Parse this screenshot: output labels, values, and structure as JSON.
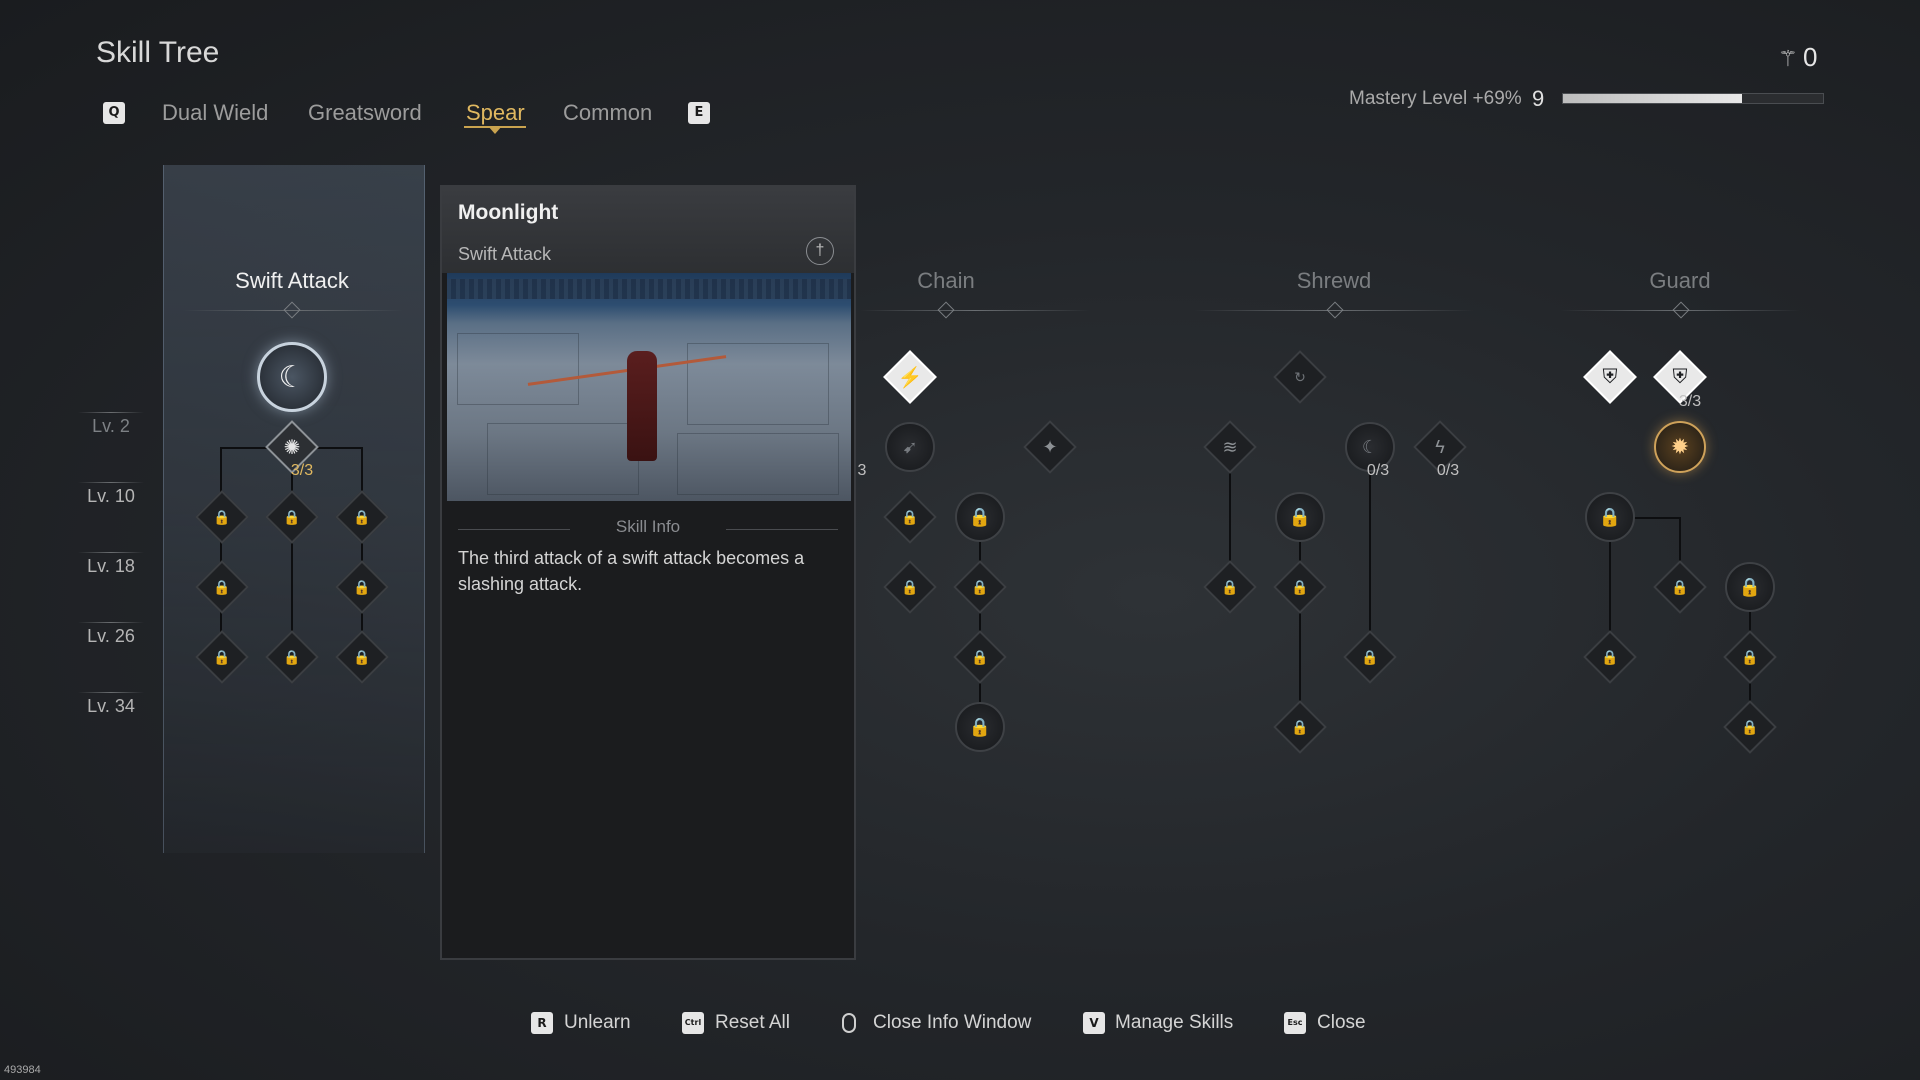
{
  "header": {
    "title": "Skill Tree",
    "prev_key": "Q",
    "next_key": "E",
    "tabs": [
      {
        "label": "Dual Wield",
        "active": false
      },
      {
        "label": "Greatsword",
        "active": false
      },
      {
        "label": "Spear",
        "active": true
      },
      {
        "label": "Common",
        "active": false
      }
    ],
    "currency_icon": "skill-point-icon",
    "currency_value": "0",
    "mastery_label": "Mastery Level +69%",
    "mastery_level": "9",
    "mastery_progress": 0.69
  },
  "levels": [
    "Lv. 2",
    "Lv. 10",
    "Lv. 18",
    "Lv. 26",
    "Lv. 34"
  ],
  "columns": [
    {
      "title": "Swift Attack",
      "active": true
    },
    {
      "title": "Chain",
      "active": false
    },
    {
      "title": "Shrewd",
      "active": false
    },
    {
      "title": "Guard",
      "active": false
    }
  ],
  "ranks": {
    "swift_lv2": "3/3",
    "chain_lv2_partial": "3",
    "shrewd_a": "0/3",
    "shrewd_b": "0/3",
    "guard_top": "3/3"
  },
  "info": {
    "name": "Moonlight",
    "category": "Swift Attack",
    "section": "Skill Info",
    "description": "The third attack of a swift attack becomes a slashing attack."
  },
  "footer": [
    {
      "key": "R",
      "label": "Unlearn"
    },
    {
      "key": "Ctrl",
      "label": "Reset All"
    },
    {
      "key": "mouse",
      "label": "Close Info Window"
    },
    {
      "key": "V",
      "label": "Manage Skills"
    },
    {
      "key": "Esc",
      "label": "Close"
    }
  ],
  "build_id": "493984",
  "colors": {
    "accent": "#e0b860",
    "text": "#d4d4d4",
    "dim": "#7a7d80"
  }
}
